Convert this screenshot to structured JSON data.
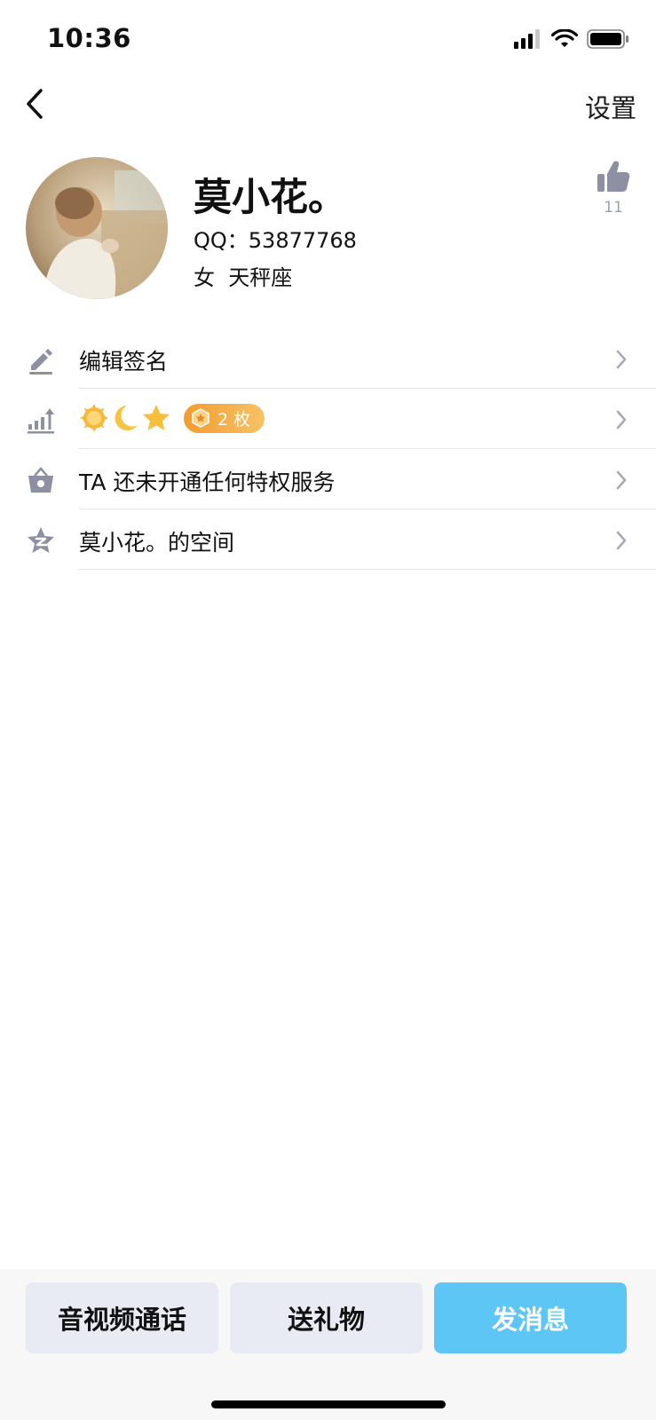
{
  "status_bar": {
    "time": "10:36"
  },
  "nav": {
    "settings_label": "设置"
  },
  "profile": {
    "name": "莫小花。",
    "qq_line": "QQ：53877768",
    "gender": "女",
    "zodiac": "天秤座",
    "like_count": "11"
  },
  "list": {
    "signature_label": "编辑签名",
    "badges": [
      "sun-badge-icon",
      "moon-badge-icon",
      "star-badge-icon"
    ],
    "medal_pill": "2 枚",
    "privilege_label": "TA 还未开通任何特权服务",
    "space_label": "莫小花。的空间"
  },
  "bottom": {
    "call_label": "音视频通话",
    "gift_label": "送礼物",
    "message_label": "发消息"
  },
  "colors": {
    "accent_blue": "#5ec6f5",
    "button_gray": "#e8ebf3",
    "icon_gray": "#8d90a3",
    "pill_orange": "#f39c2f"
  }
}
